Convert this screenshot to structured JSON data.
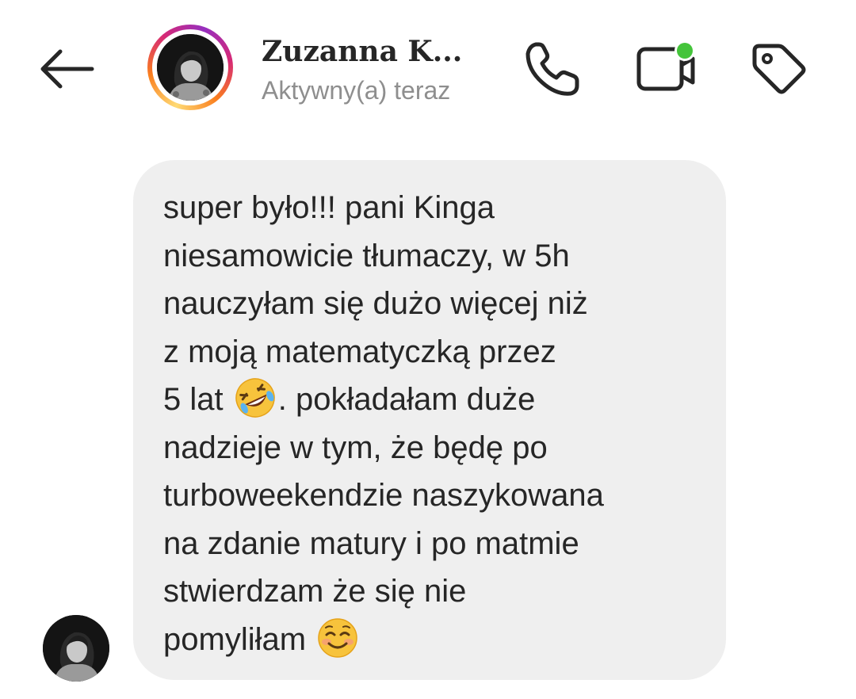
{
  "header": {
    "contact_name": "Zuzanna K...",
    "status": "Aktywny(a) teraz",
    "online_indicator_color": "#44c43a",
    "story_ring_colors": [
      "#feda75",
      "#fa7e1e",
      "#d62976",
      "#962fbf"
    ],
    "icons": [
      "back-arrow-icon",
      "phone-icon",
      "video-call-icon",
      "tag-icon"
    ]
  },
  "message": {
    "sender": "Zuzanna K...",
    "bubble_color": "#efefef",
    "lines": [
      {
        "text": "super było!!! pani Kinga"
      },
      {
        "text": "niesamowicie tłumaczy, w 5h"
      },
      {
        "text": "nauczyłam się dużo więcej niż"
      },
      {
        "text": "z moją matematyczką przez"
      },
      {
        "before": "5 lat ",
        "emoji": "rolling-on-floor-laughing-emoji",
        "after": ". pokładałam duże"
      },
      {
        "text": "nadzieje w tym, że będę po"
      },
      {
        "text": "turboweekendzie naszykowana"
      },
      {
        "text": "na zdanie matury i po matmie"
      },
      {
        "text": "stwierdzam że się nie"
      },
      {
        "before": "pomyliłam ",
        "emoji": "smiling-face-emoji",
        "after": ""
      }
    ]
  }
}
